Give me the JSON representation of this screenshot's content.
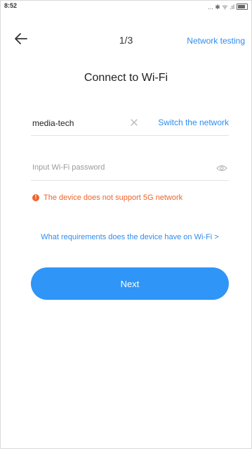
{
  "status_bar": {
    "time": "8:52",
    "icons": "... ✱ ᯤ .ıl"
  },
  "header": {
    "back_icon": "back-arrow-icon",
    "step": "1/3",
    "network_testing": "Network testing"
  },
  "title": "Connect to Wi-Fi",
  "network": {
    "ssid": "media-tech",
    "switch_label": "Switch the network"
  },
  "password": {
    "placeholder": "Input Wi-Fi password",
    "value": ""
  },
  "warning": {
    "text": "The device does not support 5G network",
    "icon_glyph": "!"
  },
  "requirements_link": "What requirements does the device have on Wi-Fi >",
  "next_label": "Next",
  "colors": {
    "accent": "#2f95f6",
    "link": "#2f8cf0",
    "warning": "#f0632a"
  }
}
